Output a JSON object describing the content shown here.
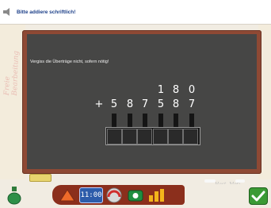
{
  "header": {
    "title": "Bitte addiere schriftlich!"
  },
  "board": {
    "instruction": "Vergiss die Überträge nicht, sofern nötig!",
    "plus": "+",
    "carry": [
      "1",
      "8",
      "0"
    ],
    "digits": [
      "5",
      "8",
      "7",
      "5",
      "8",
      "7"
    ],
    "answer_boxes": [
      "",
      "",
      "",
      "",
      "",
      ""
    ]
  },
  "decor": {
    "handwriting_left": "Freie Bearbeitung",
    "handwriting_right": "Hast, Meti"
  },
  "toolbar": {
    "clock_display": "11:00",
    "icons": [
      "bottle-icon",
      "triangle-icon",
      "clock-icon",
      "gauge-icon",
      "camera-icon",
      "chart-icon",
      "check-icon"
    ]
  },
  "colors": {
    "board": "#464645",
    "frame": "#8e4934",
    "title": "#1c3f88",
    "check": "#3b9a35"
  }
}
